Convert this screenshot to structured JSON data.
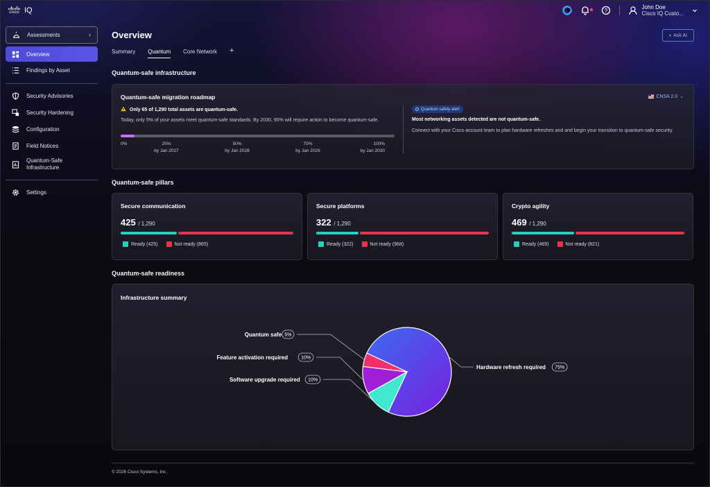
{
  "app": {
    "brand_small": "cisco",
    "brand": "IQ"
  },
  "user": {
    "name": "John Doe",
    "org": "Cisco IQ Custo..."
  },
  "icons": {
    "copilot": "copilot-icon",
    "bell": "bell-icon",
    "help": "help-icon",
    "user": "user-icon",
    "chevron": "chevron-down-icon"
  },
  "sidebar": {
    "assessments": "Assessments",
    "items": [
      {
        "label": "Overview",
        "icon": "grid-icon"
      },
      {
        "label": "Findings by Asset",
        "icon": "list-icon"
      }
    ],
    "group2": [
      {
        "label": "Security Advisories",
        "icon": "shield-icon"
      },
      {
        "label": "Security Hardening",
        "icon": "hardening-icon"
      },
      {
        "label": "Configuration",
        "icon": "stack-icon"
      },
      {
        "label": "Field Notices",
        "icon": "document-icon"
      },
      {
        "label": "Quantum-Safe Infrastructure",
        "icon": "quantum-icon"
      }
    ],
    "settings": "Settings"
  },
  "page": {
    "title": "Overview",
    "ask_ai": "Ask AI",
    "tabs": [
      "Summary",
      "Quantum",
      "Core Network"
    ],
    "add_tab": "+"
  },
  "infra": {
    "section_title": "Quantum-safe infrastructure",
    "card_title": "Quantum-safe migration roadmap",
    "warning": "Only 65 of 1,290 total assets are quantum-safe.",
    "description": "Today, only 5% of your assets meet quantum-safe standards. By 2030, 95% will require action to become quantum-safe.",
    "progress": 0.05,
    "ticks": [
      {
        "pct": "0%",
        "date": ""
      },
      {
        "pct": "25%",
        "date": "by Jan 2027"
      },
      {
        "pct": "50%",
        "date": "by Jan 2028"
      },
      {
        "pct": "75%",
        "date": "by Jan 2029"
      },
      {
        "pct": "100%",
        "date": "by Jan 2030"
      }
    ],
    "standard": "CNSA 2.0",
    "alert_badge": "Quantum safety alert",
    "alert_head": "Most networking assets detected are not quantum-safe.",
    "alert_body": "Connect with your Cisco account team to plan hardware refreshes and and begin your transition to quantum-safe security."
  },
  "pillars": {
    "section_title": "Quantum-safe pillars",
    "total_label": "/ 1,290",
    "ready_color": "#20d0c0",
    "not_ready_color": "#e8344a",
    "items": [
      {
        "title": "Secure communication",
        "ready": 425,
        "not_ready": 865,
        "ready_label": "Ready (425)",
        "not_ready_label": "Not ready (865)"
      },
      {
        "title": "Secure platforms",
        "ready": 322,
        "not_ready": 968,
        "ready_label": "Ready (322)",
        "not_ready_label": "Not ready (968)"
      },
      {
        "title": "Crypto agility",
        "ready": 469,
        "not_ready": 821,
        "ready_label": "Ready (469)",
        "not_ready_label": "Not ready (821)"
      }
    ]
  },
  "readiness": {
    "section_title": "Quantum-safe readiness",
    "card_title": "Infrastructure summary"
  },
  "chart_data": {
    "type": "pie",
    "title": "Infrastructure summary",
    "slices": [
      {
        "label": "Hardware refresh required",
        "value": 75,
        "badge": "75%",
        "color": "#4a3ee8"
      },
      {
        "label": "Software upgrade required",
        "value": 10,
        "badge": "10%",
        "color": "#40e8d0"
      },
      {
        "label": "Feature activation required",
        "value": 10,
        "badge": "10%",
        "color": "#a020d8"
      },
      {
        "label": "Quantum safe",
        "value": 5,
        "badge": "5%",
        "color": "#f0306a"
      }
    ]
  },
  "footer": "© 2026 Cisco Systems, Inc."
}
